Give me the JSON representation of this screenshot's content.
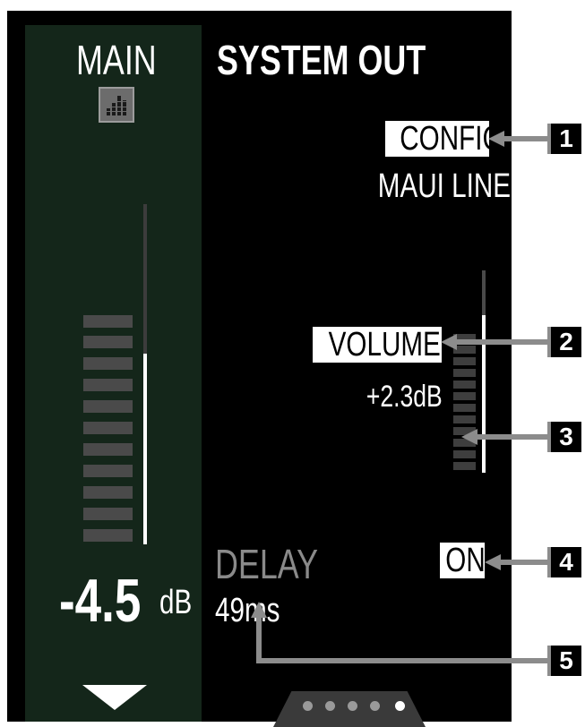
{
  "main_channel": {
    "title": "MAIN",
    "level_value": "-4.5",
    "level_unit": "dB",
    "meter_icon": "eq-bars-icon",
    "scroll_icon": "triangle-down-icon"
  },
  "system_out": {
    "title": "SYSTEM OUT",
    "config_label": "CONFIG",
    "config_value": "MAUI LINE",
    "volume_label": "VOLUME",
    "volume_value": "+2.3dB",
    "delay_label": "DELAY",
    "delay_value": "49ms",
    "status": "ON"
  },
  "callouts": [
    "1",
    "2",
    "3",
    "4",
    "5"
  ],
  "pager": {
    "pages": 5,
    "active_page": 5
  },
  "colors": {
    "screen_background": "#000000",
    "main_panel": "#14261a",
    "label_box": "#ffffff",
    "meter_segment": "#4a4a4a",
    "callout_line": "#8c8c8c"
  }
}
